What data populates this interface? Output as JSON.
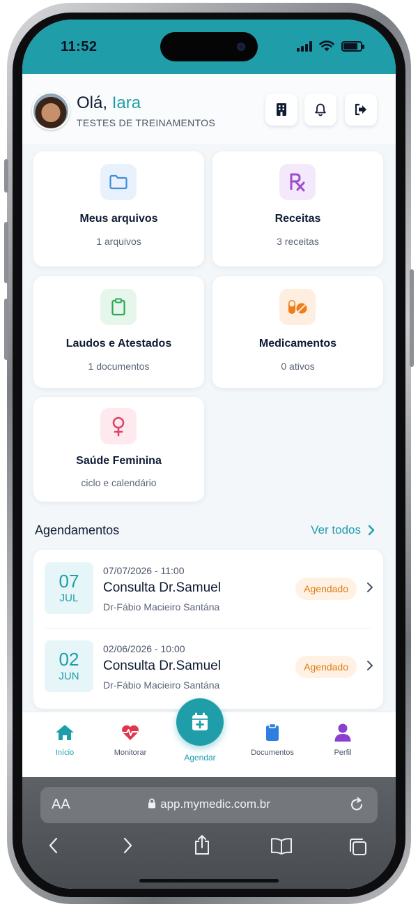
{
  "status_bar": {
    "time": "11:52"
  },
  "header": {
    "greeting": "Olá,",
    "name": "Iara",
    "subtitle": "TESTES DE TREINAMENTOS"
  },
  "cards": [
    {
      "title": "Meus arquivos",
      "subtitle": "1 arquivos",
      "icon": "folder-icon",
      "color": "#3f8fd8"
    },
    {
      "title": "Receitas",
      "subtitle": "3 receitas",
      "icon": "prescription-icon",
      "color": "#9b4fd0"
    },
    {
      "title": "Laudos e Atestados",
      "subtitle": "1 documentos",
      "icon": "clipboard-icon",
      "color": "#2fa65a"
    },
    {
      "title": "Medicamentos",
      "subtitle": "0 ativos",
      "icon": "pills-icon",
      "color": "#ef7d1a"
    },
    {
      "title": "Saúde Feminina",
      "subtitle": "ciclo e calendário",
      "icon": "female-icon",
      "color": "#e0436a"
    }
  ],
  "appointments": {
    "title": "Agendamentos",
    "see_all": "Ver todos",
    "items": [
      {
        "day": "07",
        "month": "JUL",
        "datetime": "07/07/2026 - 11:00",
        "title": "Consulta Dr.Samuel",
        "doctor": "Dr-Fábio Macieiro Santána",
        "status": "Agendado"
      },
      {
        "day": "02",
        "month": "JUN",
        "datetime": "02/06/2026 - 10:00",
        "title": "Consulta Dr.Samuel",
        "doctor": "Dr-Fábio Macieiro Santána",
        "status": "Agendado"
      }
    ]
  },
  "nav": {
    "items": [
      {
        "label": "Início",
        "icon": "home-icon"
      },
      {
        "label": "Monitorar",
        "icon": "heart-pulse-icon"
      },
      {
        "label": "Agendar",
        "icon": "calendar-plus-icon"
      },
      {
        "label": "Documentos",
        "icon": "clipboard-icon"
      },
      {
        "label": "Perfil",
        "icon": "user-icon"
      }
    ]
  },
  "browser": {
    "text_size": "AA",
    "url": "app.mymedic.com.br"
  },
  "colors": {
    "accent": "#1f9eaa",
    "status_badge_bg": "#fff1e3",
    "status_badge_text": "#e07a12"
  }
}
